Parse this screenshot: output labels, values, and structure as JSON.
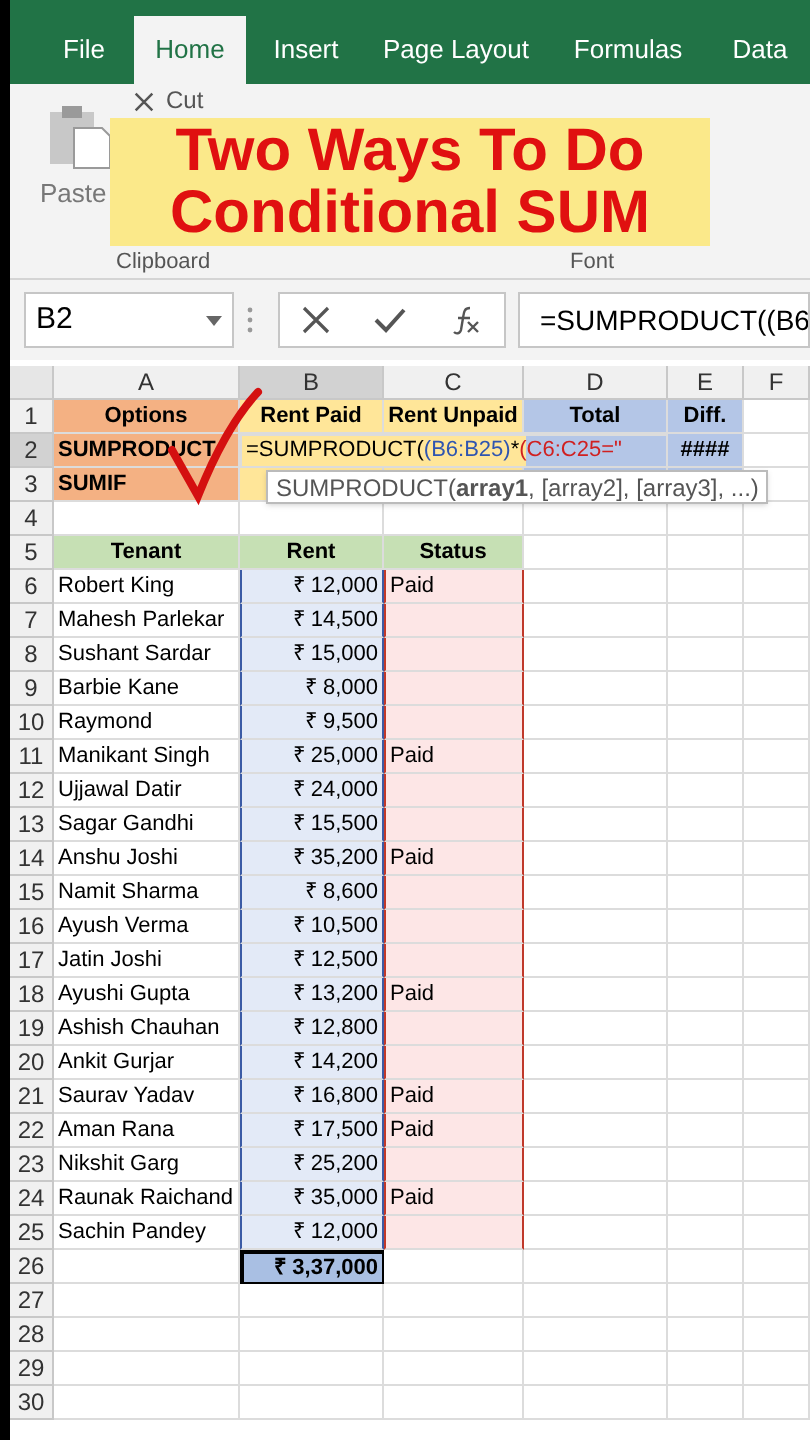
{
  "ribbon_tabs": [
    {
      "label": "File",
      "selected": false
    },
    {
      "label": "Home",
      "selected": true
    },
    {
      "label": "Insert",
      "selected": false
    },
    {
      "label": "Page Layout",
      "selected": false
    },
    {
      "label": "Formulas",
      "selected": false
    },
    {
      "label": "Data",
      "selected": false
    }
  ],
  "ribbon": {
    "paste": "Paste",
    "cut": "Cut",
    "groups": [
      "Clipboard",
      "Font"
    ]
  },
  "banner": {
    "lines": [
      "Two Ways To Do",
      "Conditional SUM"
    ]
  },
  "formula_bar": {
    "name_box": "B2",
    "formula": "=SUMPRODUCT((B6"
  },
  "columns": [
    {
      "label": "A",
      "selected": false
    },
    {
      "label": "B",
      "selected": true
    },
    {
      "label": "C",
      "selected": false
    },
    {
      "label": "D",
      "selected": false
    },
    {
      "label": "E",
      "selected": false
    },
    {
      "label": "F",
      "selected": false
    }
  ],
  "rows": [
    {
      "number": "1",
      "selected": false,
      "cells": [
        {
          "text": "Options",
          "kind": "option-head"
        },
        {
          "text": "Rent Paid",
          "kind": "paid"
        },
        {
          "text": "Rent Unpaid",
          "kind": "paid"
        },
        {
          "text": "Total",
          "kind": "total"
        },
        {
          "text": "Diff.",
          "kind": "total"
        }
      ]
    },
    {
      "number": "2",
      "selected": true,
      "cells": [
        {
          "text": "SUMPRODUCT",
          "kind": "option"
        },
        {
          "kind": "formula",
          "segments": [
            {
              "text": "=SUMPRODUCT("
            },
            {
              "text": "(B6:B25)",
              "color": "#2f55b0"
            },
            {
              "text": "*"
            },
            {
              "text": "(C6:C25=\"",
              "color": "#d02020"
            }
          ]
        },
        {
          "text": "####",
          "kind": "total"
        }
      ]
    },
    {
      "number": "3",
      "selected": false,
      "cells": [
        {
          "text": "SUMIF",
          "kind": "option"
        },
        {
          "kind": "paid"
        },
        {
          "kind": "paid"
        },
        {
          "kind": "total"
        },
        {
          "kind": "total"
        }
      ]
    },
    {
      "number": "4",
      "selected": false,
      "cells": []
    },
    {
      "number": "5",
      "selected": false,
      "cells": [
        {
          "text": "Tenant",
          "kind": "head"
        },
        {
          "text": "Rent",
          "kind": "head"
        },
        {
          "text": "Status",
          "kind": "head"
        }
      ]
    },
    {
      "number": "6",
      "selected": false,
      "cells": [
        {
          "text": "Robert King"
        },
        {
          "text": "₹ 12,000",
          "kind": "rent"
        },
        {
          "text": "Paid",
          "kind": "status"
        }
      ]
    },
    {
      "number": "7",
      "selected": false,
      "cells": [
        {
          "text": "Mahesh Parlekar"
        },
        {
          "text": "₹ 14,500",
          "kind": "rent"
        },
        {
          "kind": "status"
        }
      ]
    },
    {
      "number": "8",
      "selected": false,
      "cells": [
        {
          "text": "Sushant Sardar"
        },
        {
          "text": "₹ 15,000",
          "kind": "rent"
        },
        {
          "kind": "status"
        }
      ]
    },
    {
      "number": "9",
      "selected": false,
      "cells": [
        {
          "text": "Barbie Kane"
        },
        {
          "text": "₹ 8,000",
          "kind": "rent"
        },
        {
          "kind": "status"
        }
      ]
    },
    {
      "number": "10",
      "selected": false,
      "cells": [
        {
          "text": "Raymond"
        },
        {
          "text": "₹ 9,500",
          "kind": "rent"
        },
        {
          "kind": "status"
        }
      ]
    },
    {
      "number": "11",
      "selected": false,
      "cells": [
        {
          "text": "Manikant Singh"
        },
        {
          "text": "₹ 25,000",
          "kind": "rent"
        },
        {
          "text": "Paid",
          "kind": "status"
        }
      ]
    },
    {
      "number": "12",
      "selected": false,
      "cells": [
        {
          "text": "Ujjawal Datir"
        },
        {
          "text": "₹ 24,000",
          "kind": "rent"
        },
        {
          "kind": "status"
        }
      ]
    },
    {
      "number": "13",
      "selected": false,
      "cells": [
        {
          "text": "Sagar Gandhi"
        },
        {
          "text": "₹ 15,500",
          "kind": "rent"
        },
        {
          "kind": "status"
        }
      ]
    },
    {
      "number": "14",
      "selected": false,
      "cells": [
        {
          "text": "Anshu Joshi"
        },
        {
          "text": "₹ 35,200",
          "kind": "rent"
        },
        {
          "text": "Paid",
          "kind": "status"
        }
      ]
    },
    {
      "number": "15",
      "selected": false,
      "cells": [
        {
          "text": "Namit Sharma"
        },
        {
          "text": "₹ 8,600",
          "kind": "rent"
        },
        {
          "kind": "status"
        }
      ]
    },
    {
      "number": "16",
      "selected": false,
      "cells": [
        {
          "text": "Ayush Verma"
        },
        {
          "text": "₹ 10,500",
          "kind": "rent"
        },
        {
          "kind": "status"
        }
      ]
    },
    {
      "number": "17",
      "selected": false,
      "cells": [
        {
          "text": "Jatin Joshi"
        },
        {
          "text": "₹ 12,500",
          "kind": "rent"
        },
        {
          "kind": "status"
        }
      ]
    },
    {
      "number": "18",
      "selected": false,
      "cells": [
        {
          "text": "Ayushi Gupta"
        },
        {
          "text": "₹ 13,200",
          "kind": "rent"
        },
        {
          "text": "Paid",
          "kind": "status"
        }
      ]
    },
    {
      "number": "19",
      "selected": false,
      "cells": [
        {
          "text": "Ashish Chauhan"
        },
        {
          "text": "₹ 12,800",
          "kind": "rent"
        },
        {
          "kind": "status"
        }
      ]
    },
    {
      "number": "20",
      "selected": false,
      "cells": [
        {
          "text": "Ankit Gurjar"
        },
        {
          "text": "₹ 14,200",
          "kind": "rent"
        },
        {
          "kind": "status"
        }
      ]
    },
    {
      "number": "21",
      "selected": false,
      "cells": [
        {
          "text": "Saurav Yadav"
        },
        {
          "text": "₹ 16,800",
          "kind": "rent"
        },
        {
          "text": "Paid",
          "kind": "status"
        }
      ]
    },
    {
      "number": "22",
      "selected": false,
      "cells": [
        {
          "text": "Aman Rana"
        },
        {
          "text": "₹ 17,500",
          "kind": "rent"
        },
        {
          "text": "Paid",
          "kind": "status"
        }
      ]
    },
    {
      "number": "23",
      "selected": false,
      "cells": [
        {
          "text": "Nikshit Garg"
        },
        {
          "text": "₹ 25,200",
          "kind": "rent"
        },
        {
          "kind": "status"
        }
      ]
    },
    {
      "number": "24",
      "selected": false,
      "cells": [
        {
          "text": "Raunak Raichand"
        },
        {
          "text": "₹ 35,000",
          "kind": "rent"
        },
        {
          "text": "Paid",
          "kind": "status"
        }
      ]
    },
    {
      "number": "25",
      "selected": false,
      "cells": [
        {
          "text": "Sachin Pandey"
        },
        {
          "text": "₹ 12,000",
          "kind": "rent"
        },
        {
          "kind": "status"
        }
      ]
    },
    {
      "number": "26",
      "selected": false,
      "cells": [
        {},
        {
          "text": "₹ 3,37,000",
          "kind": "sum"
        }
      ]
    },
    {
      "number": "27",
      "selected": false,
      "cells": []
    },
    {
      "number": "28",
      "selected": false,
      "cells": []
    },
    {
      "number": "29",
      "selected": false,
      "cells": []
    },
    {
      "number": "30",
      "selected": false,
      "cells": []
    }
  ],
  "tooltip": "SUMPRODUCT(**array1**, [array2], [array3], ...)"
}
